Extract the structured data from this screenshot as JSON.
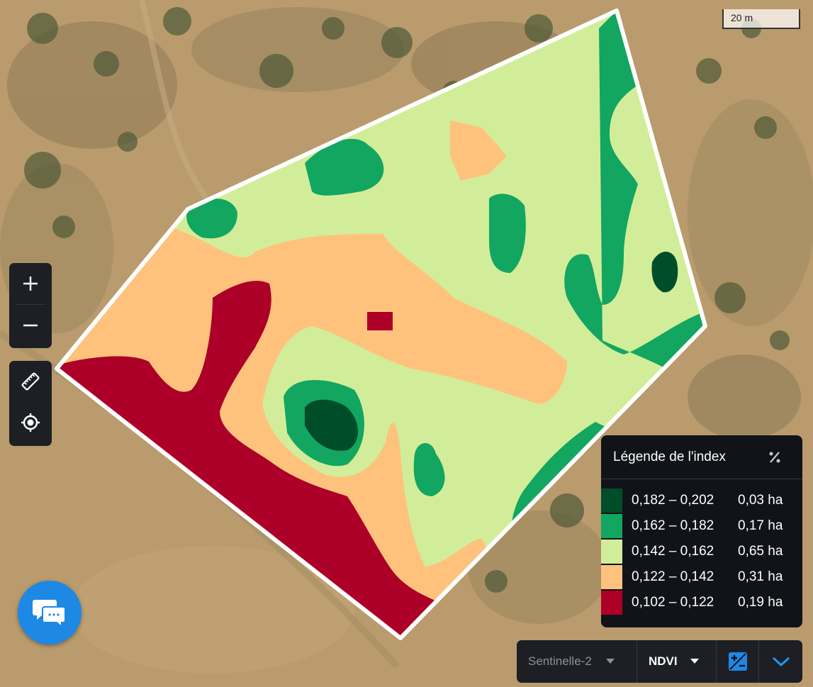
{
  "scale": {
    "label": "20 m"
  },
  "zoom": {
    "in_icon": "plus-icon",
    "out_icon": "minus-icon"
  },
  "tools": {
    "ruler_icon": "ruler-icon",
    "locate_icon": "crosshair-icon"
  },
  "legend": {
    "title": "Légende de l'index",
    "toggle_icon": "percent-icon",
    "rows": [
      {
        "range": "0,182 – 0,202",
        "area": "0,03 ha",
        "color": "#004d2a"
      },
      {
        "range": "0,162 – 0,182",
        "area": "0,17 ha",
        "color": "#12a660"
      },
      {
        "range": "0,142 – 0,162",
        "area": "0,65 ha",
        "color": "#d2ed99"
      },
      {
        "range": "0,122 – 0,142",
        "area": "0,31 ha",
        "color": "#fec27c"
      },
      {
        "range": "0,102 – 0,122",
        "area": "0,19 ha",
        "color": "#ac0028"
      }
    ]
  },
  "chat": {
    "icon": "chat-icon"
  },
  "bottom_bar": {
    "source": "Sentinelle-2",
    "index": "NDVI",
    "image_icon": "image-compare-icon",
    "expand_icon": "chevron-down-icon"
  }
}
